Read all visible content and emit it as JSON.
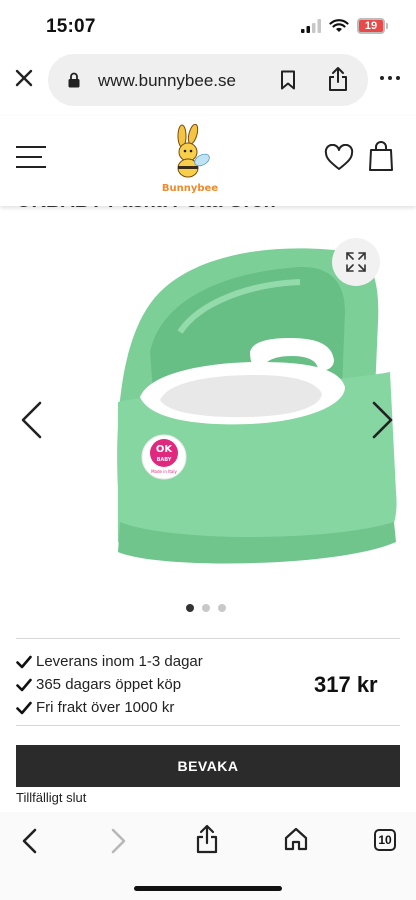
{
  "status_bar": {
    "time": "15:07",
    "battery_level": "19",
    "icons": [
      "signal-icon",
      "wifi-icon",
      "battery-icon"
    ],
    "battery_color": "#e84a4a"
  },
  "browser": {
    "url": "www.bunnybee.se",
    "icons": [
      "close-icon",
      "lock-icon",
      "bookmark-icon",
      "share-icon",
      "more-icon"
    ]
  },
  "site_header": {
    "logo_text": "Bunnybee",
    "icons": [
      "hamburger-menu-icon",
      "heart-icon",
      "shopping-bag-icon"
    ]
  },
  "product": {
    "title": "OKBABY Pasha Potta Grön",
    "image_alt": "green-potty",
    "badge_brand": "OK",
    "badge_sub": "BABY",
    "badge_small": "Made in Italy",
    "carousel": {
      "count": 3,
      "active_index": 0
    },
    "color_main": "#7dcf98",
    "color_seat": "#ffffff"
  },
  "features": [
    "Leverans inom 1-3 dagar",
    "365 dagars öppet köp",
    "Fri frakt över 1000 kr"
  ],
  "price": "317 kr",
  "buttons": {
    "bevaka": "BEVAKA"
  },
  "stock_note": "Tillfälligt slut",
  "bottom_toolbar": {
    "tabs_count": "10",
    "icons": [
      "back-icon",
      "forward-icon",
      "share-icon",
      "home-icon",
      "tabs-icon"
    ]
  }
}
